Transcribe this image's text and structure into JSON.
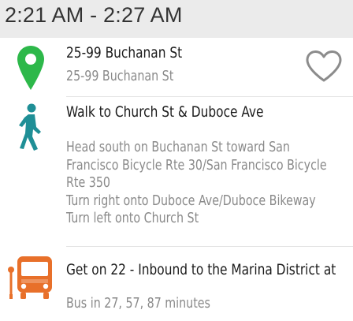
{
  "header": {
    "time_range": "2:21 AM - 2:27 AM"
  },
  "steps": [
    {
      "icon": "location-pin-icon",
      "title": "25-99 Buchanan St",
      "subtitle": "25-99 Buchanan St",
      "favorite_icon": "heart-outline-icon"
    },
    {
      "icon": "walking-person-icon",
      "title": "Walk to Church St & Duboce Ave",
      "directions": [
        "Head south on Buchanan St toward San",
        "Francisco Bicycle Rte 30/San Francisco Bicycle",
        "Rte 350",
        "Turn right onto Duboce Ave/Duboce Bikeway",
        "Turn left onto Church St"
      ]
    },
    {
      "icon": "bus-stop-icon",
      "title": "Get on 22 - Inbound to the Marina District at",
      "subtitle": "Bus in 27, 57, 87 minutes"
    }
  ],
  "colors": {
    "pin": "#2db84a",
    "walk": "#1f8f96",
    "bus": "#e8702a",
    "header_bg": "#ebebeb"
  }
}
